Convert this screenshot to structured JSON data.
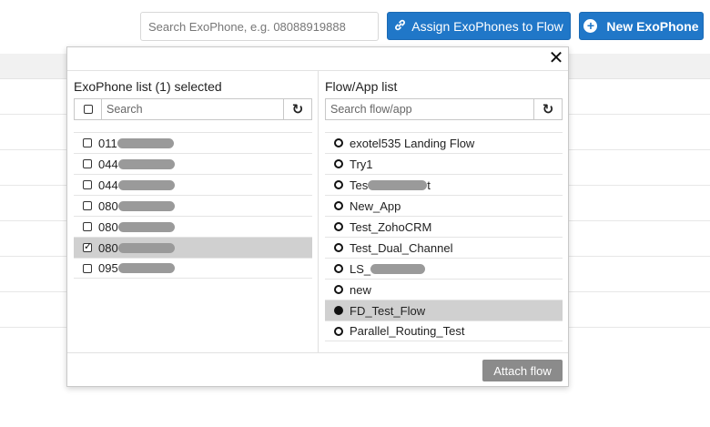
{
  "header": {
    "search_placeholder": "Search ExoPhone, e.g. 08088919888",
    "assign_label": "Assign ExoPhones to Flow",
    "new_label": "New ExoPhone"
  },
  "modal": {
    "left": {
      "title": "ExoPhone list (1) selected",
      "search_placeholder": "Search",
      "items": [
        {
          "label": "011",
          "checked": false
        },
        {
          "label": "044",
          "checked": false
        },
        {
          "label": "044",
          "checked": false
        },
        {
          "label": "080",
          "checked": false
        },
        {
          "label": "080",
          "checked": false
        },
        {
          "label": "080",
          "checked": true
        },
        {
          "label": "095",
          "checked": false
        }
      ]
    },
    "right": {
      "title": "Flow/App list",
      "search_placeholder": "Search flow/app",
      "items": [
        {
          "label": "exotel535 Landing Flow",
          "selected": false
        },
        {
          "label": "Try1",
          "selected": false
        },
        {
          "label": "Tes",
          "suffix": "t",
          "selected": false
        },
        {
          "label": "New_App",
          "selected": false
        },
        {
          "label": "Test_ZohoCRM",
          "selected": false
        },
        {
          "label": "Test_Dual_Channel",
          "selected": false
        },
        {
          "label": "LS_",
          "selected": false
        },
        {
          "label": "new",
          "selected": false
        },
        {
          "label": "FD_Test_Flow",
          "selected": true
        },
        {
          "label": "Parallel_Routing_Test",
          "selected": false
        }
      ]
    },
    "attach_label": "Attach flow",
    "close_label": "✕"
  }
}
